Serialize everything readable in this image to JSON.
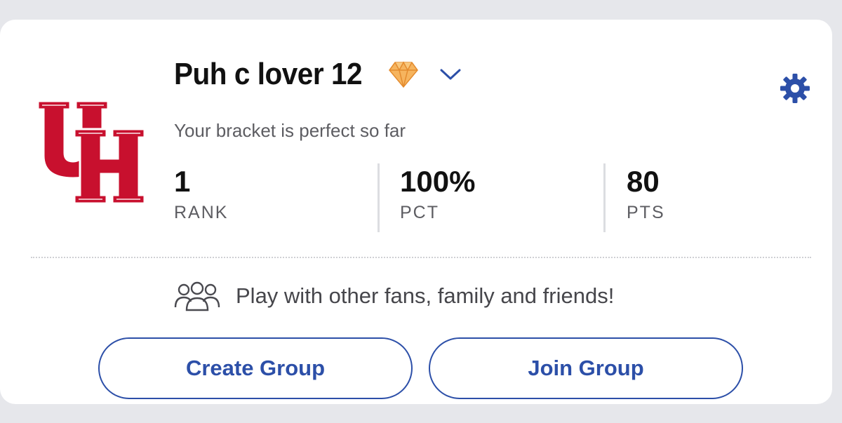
{
  "colors": {
    "accent": "#2c4fa8",
    "team_red": "#c8102e",
    "gem": "#f2a34b",
    "text_primary": "#111111",
    "text_secondary": "#5d5d62",
    "page_bg": "#e6e7eb"
  },
  "header": {
    "team_logo_icon": "uh-logo-icon",
    "bracket_name": "Puh c lover 12",
    "badge_icon": "gem-icon",
    "dropdown_icon": "chevron-down-icon",
    "settings_icon": "gear-icon",
    "status": "Your bracket is perfect so far"
  },
  "stats": [
    {
      "value": "1",
      "label": "RANK"
    },
    {
      "value": "100%",
      "label": "PCT"
    },
    {
      "value": "80",
      "label": "PTS"
    }
  ],
  "invite": {
    "icon": "people-group-icon",
    "text": "Play with other fans, family and friends!"
  },
  "actions": {
    "create_label": "Create Group",
    "join_label": "Join Group"
  }
}
